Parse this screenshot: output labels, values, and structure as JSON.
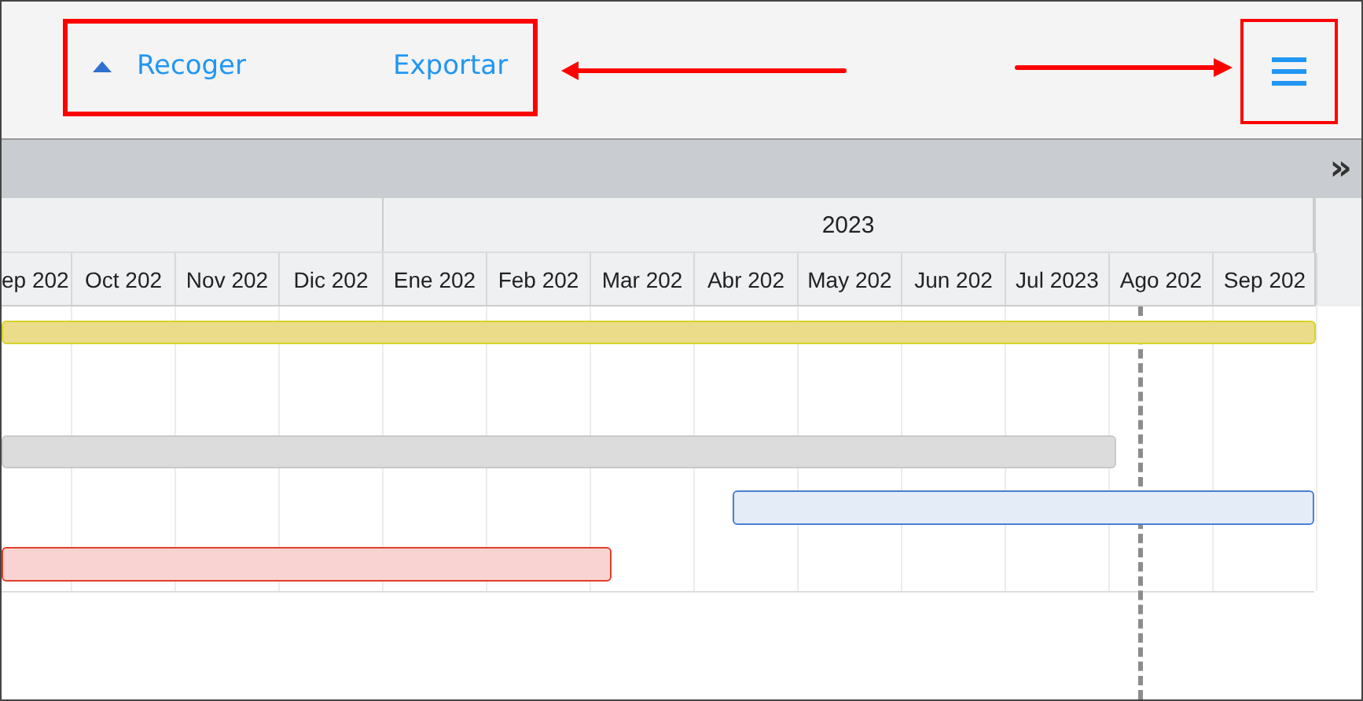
{
  "toolbar": {
    "collapse_button": {
      "label": "Recoger"
    },
    "export_button": {
      "label": "Exportar"
    }
  },
  "scroll_bar": {
    "expand_label": "»"
  },
  "timeline": {
    "year": "2023",
    "months": [
      "ep 202",
      "Oct 202",
      "Nov 202",
      "Dic 202",
      "Ene 202",
      "Feb 202",
      "Mar 202",
      "Abr 202",
      "May 202",
      "Jun 202",
      "Jul 2023",
      "Ago 202",
      "Sep 202"
    ]
  },
  "tasks": [
    {
      "color": "#ebdc8a"
    },
    {
      "color": "#dcdcdc"
    },
    {
      "color": "#e4ecf7"
    },
    {
      "color": "#f8d3d1"
    }
  ]
}
